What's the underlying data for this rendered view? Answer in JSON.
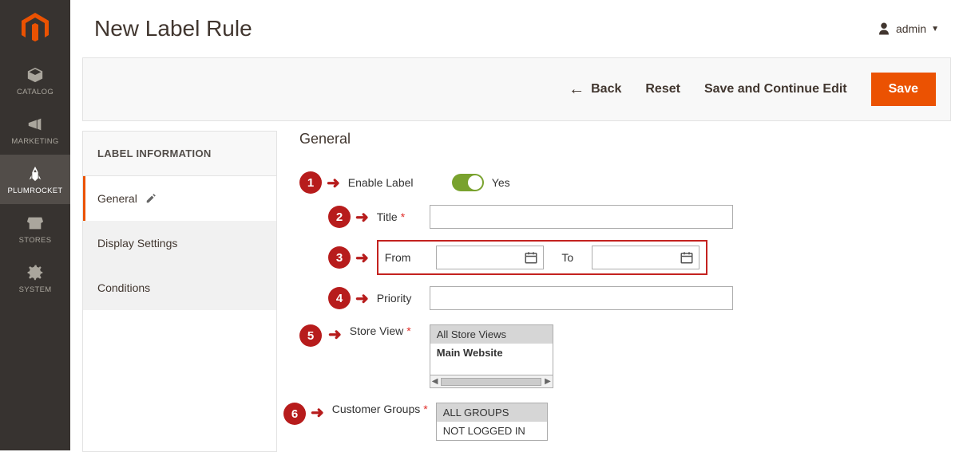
{
  "page_title": "New Label Rule",
  "user_name": "admin",
  "nav": [
    {
      "label": "CATALOG"
    },
    {
      "label": "MARKETING"
    },
    {
      "label": "PLUMROCKET"
    },
    {
      "label": "STORES"
    },
    {
      "label": "SYSTEM"
    }
  ],
  "actions": {
    "back": "Back",
    "reset": "Reset",
    "save_continue": "Save and Continue Edit",
    "save": "Save"
  },
  "side_tabs": {
    "header": "LABEL INFORMATION",
    "general": "General",
    "display": "Display Settings",
    "conditions": "Conditions"
  },
  "section_title": "General",
  "fields": {
    "enable": {
      "label": "Enable Label",
      "value_label": "Yes"
    },
    "title": {
      "label": "Title",
      "value": ""
    },
    "from": {
      "label": "From",
      "value": ""
    },
    "to": {
      "label": "To",
      "value": ""
    },
    "priority": {
      "label": "Priority",
      "value": ""
    },
    "store_view": {
      "label": "Store View",
      "opt1": "All Store Views",
      "opt2": "Main Website"
    },
    "customer_groups": {
      "label": "Customer Groups",
      "opt1": "ALL GROUPS",
      "opt2": "NOT LOGGED IN"
    }
  },
  "badges": {
    "b1": "1",
    "b2": "2",
    "b3": "3",
    "b4": "4",
    "b5": "5",
    "b6": "6"
  }
}
